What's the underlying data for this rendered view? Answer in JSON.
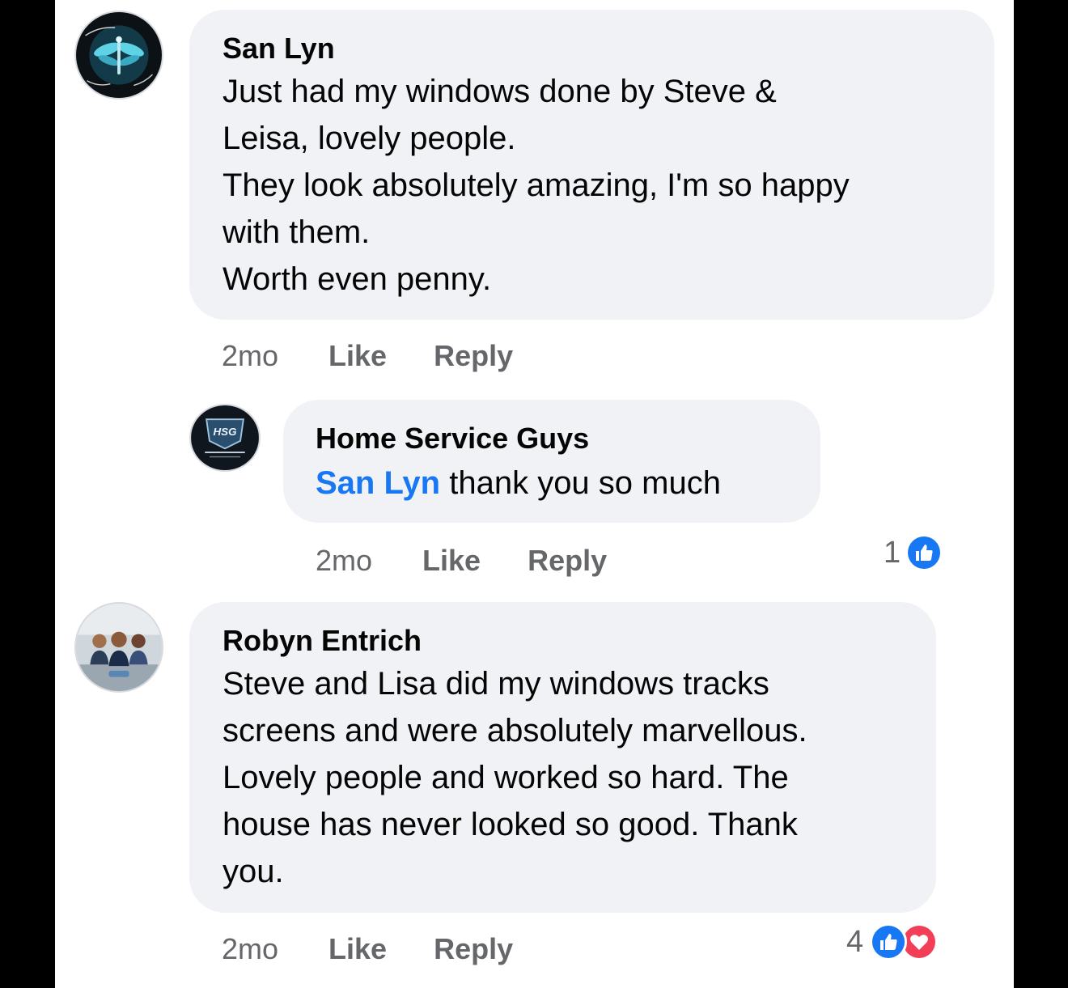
{
  "comments": [
    {
      "author": "San Lyn",
      "lines": [
        "Just had my windows done by Steve &",
        "Leisa, lovely people.",
        "They look absolutely amazing, I'm so happy",
        "with them.",
        "Worth even penny."
      ],
      "time": "2mo",
      "like_label": "Like",
      "reply_label": "Reply",
      "avatar_icon": "dragonfly-avatar"
    },
    {
      "author": "Home Service Guys",
      "mention": "San Lyn",
      "text": " thank you so much",
      "time": "2mo",
      "like_label": "Like",
      "reply_label": "Reply",
      "reaction_count": "1",
      "reactions": [
        "like-reaction-icon"
      ],
      "avatar_logo_text": "HSG",
      "avatar_icon": "hsg-logo-avatar"
    },
    {
      "author": "Robyn Entrich",
      "lines": [
        "Steve and Lisa did my windows tracks",
        "screens and were absolutely marvellous.",
        "Lovely people and worked so hard. The",
        "house has never looked so good. Thank",
        "you."
      ],
      "time": "2mo",
      "like_label": "Like",
      "reply_label": "Reply",
      "reaction_count": "4",
      "reactions": [
        "like-reaction-icon",
        "love-reaction-icon"
      ],
      "avatar_icon": "group-photo-avatar"
    }
  ],
  "colors": {
    "bubble": "#f0f2f5",
    "text": "#050505",
    "meta": "#65676b",
    "mention": "#1877f2",
    "like": "#1877f2",
    "love": "#f33e58"
  }
}
